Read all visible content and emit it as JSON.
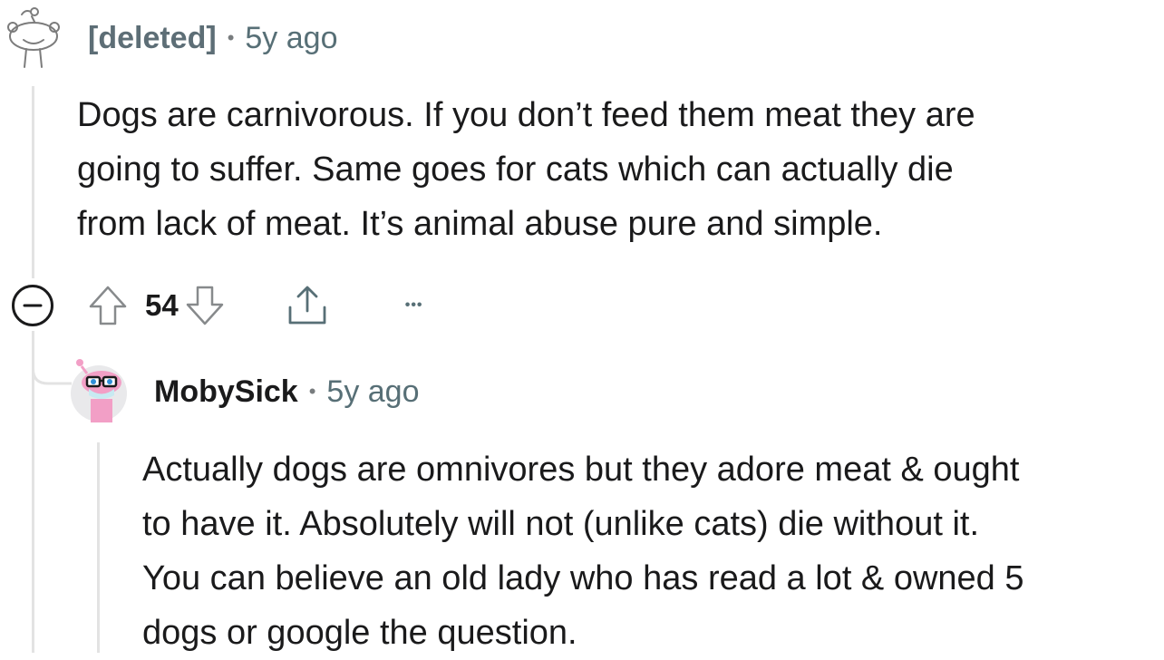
{
  "comments": [
    {
      "author": "[deleted]",
      "separator": "•",
      "age": "5y ago",
      "body_lines": [
        "Dogs are carnivorous. If you don’t feed them meat they are",
        "going to suffer. Same goes for cats which can actually die",
        "from lack of meat. It’s animal abuse pure and simple."
      ],
      "score": "54",
      "more_label": "•••"
    },
    {
      "author": "MobySick",
      "separator": "•",
      "age": "5y ago",
      "body_lines": [
        "Actually dogs are omnivores but they adore meat & ought",
        "to have it. Absolutely will not (unlike cats) die without it.",
        "You can believe an old lady who has read a lot & owned 5",
        "dogs or google the question."
      ]
    }
  ],
  "colors": {
    "text": "#1a1a1b",
    "meta": "#576f76",
    "thread_line": "#e3e3e3",
    "icon": "#878a8c",
    "avatar_pink": "#f29fc6"
  }
}
